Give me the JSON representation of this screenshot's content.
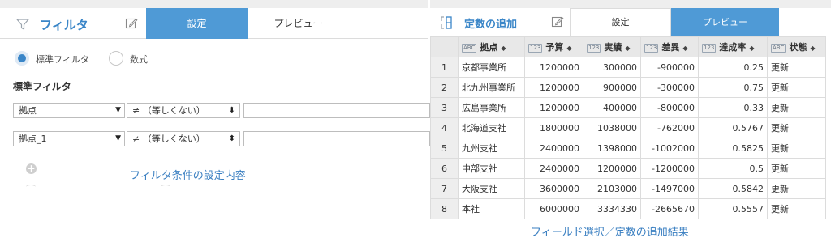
{
  "filter_panel": {
    "title": "フィルタ",
    "tabs": [
      {
        "label": "設定",
        "active": true
      },
      {
        "label": "プレビュー",
        "active": false
      }
    ],
    "radio_options": [
      {
        "label": "標準フィルタ",
        "selected": true
      },
      {
        "label": "数式",
        "selected": false
      }
    ],
    "section_label": "標準フィルタ",
    "rows": [
      {
        "field": "拠点",
        "operator": "≠ （等しくない）",
        "value": ""
      },
      {
        "field": "拠点_1",
        "operator": "≠ （等しくない）",
        "value": ""
      }
    ],
    "add_icon": "plus-circle-icon",
    "caption": "フィルタ条件の設定内容"
  },
  "constant_panel": {
    "title": "定数の追加",
    "tabs": [
      {
        "label": "設定",
        "active": false
      },
      {
        "label": "プレビュー",
        "active": true
      }
    ],
    "columns": [
      {
        "type": "ABC",
        "label": "拠点"
      },
      {
        "type": "123",
        "label": "予算"
      },
      {
        "type": "123",
        "label": "実績"
      },
      {
        "type": "123",
        "label": "差異"
      },
      {
        "type": "123",
        "label": "達成率"
      },
      {
        "type": "ABC",
        "label": "状態"
      }
    ],
    "rows": [
      {
        "n": "1",
        "cells": [
          "京都事業所",
          "1200000",
          "300000",
          "-900000",
          "0.25",
          "更新"
        ]
      },
      {
        "n": "2",
        "cells": [
          "北九州事業所",
          "1200000",
          "900000",
          "-300000",
          "0.75",
          "更新"
        ]
      },
      {
        "n": "3",
        "cells": [
          "広島事業所",
          "1200000",
          "400000",
          "-800000",
          "0.33",
          "更新"
        ]
      },
      {
        "n": "4",
        "cells": [
          "北海道支社",
          "1800000",
          "1038000",
          "-762000",
          "0.5767",
          "更新"
        ]
      },
      {
        "n": "5",
        "cells": [
          "九州支社",
          "2400000",
          "1398000",
          "-1002000",
          "0.5825",
          "更新"
        ]
      },
      {
        "n": "6",
        "cells": [
          "中部支社",
          "2400000",
          "1200000",
          "-1200000",
          "0.5",
          "更新"
        ]
      },
      {
        "n": "7",
        "cells": [
          "大阪支社",
          "3600000",
          "2103000",
          "-1497000",
          "0.5842",
          "更新"
        ]
      },
      {
        "n": "8",
        "cells": [
          "本社",
          "6000000",
          "3334330",
          "-2665670",
          "0.5557",
          "更新"
        ]
      }
    ],
    "caption": "フィールド選択／定数の追加結果"
  },
  "colors": {
    "accent": "#4f9ad6",
    "title_blue": "#3a86c8",
    "caption_blue": "#3a7fc1"
  }
}
